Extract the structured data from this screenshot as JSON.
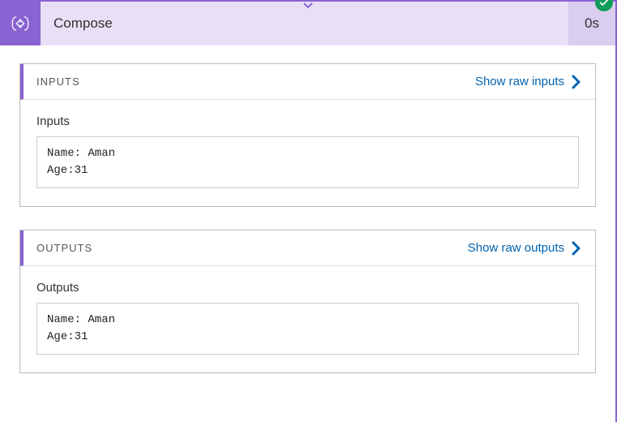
{
  "step": {
    "title": "Compose",
    "duration": "0s"
  },
  "panels": {
    "inputs": {
      "header": "INPUTS",
      "rawLink": "Show raw inputs",
      "sectionLabel": "Inputs",
      "content": "Name: Aman\nAge:31"
    },
    "outputs": {
      "header": "OUTPUTS",
      "rawLink": "Show raw outputs",
      "sectionLabel": "Outputs",
      "content": "Name: Aman\nAge:31"
    }
  }
}
